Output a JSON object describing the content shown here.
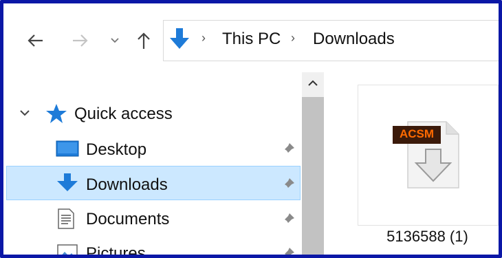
{
  "nav": {
    "back_icon": "arrow-left-icon",
    "forward_icon": "arrow-right-icon",
    "recent_icon": "chevron-down-icon",
    "up_icon": "arrow-up-icon"
  },
  "address": {
    "location_icon": "downloads-arrow-icon",
    "crumbs": [
      "This PC",
      "Downloads"
    ]
  },
  "sidebar": {
    "quick_access_label": "Quick access",
    "items": [
      {
        "label": "Desktop",
        "icon": "desktop-icon",
        "pinned": true
      },
      {
        "label": "Downloads",
        "icon": "downloads-icon",
        "pinned": true,
        "selected": true
      },
      {
        "label": "Documents",
        "icon": "documents-icon",
        "pinned": true
      },
      {
        "label": "Pictures",
        "icon": "pictures-icon",
        "pinned": true
      }
    ]
  },
  "files": [
    {
      "name": "5136588 (1)",
      "icon": "acsm-file-icon",
      "badge": "ACSM"
    }
  ],
  "colors": {
    "selection_bg": "#cce8ff",
    "accent_blue": "#1e7bd8",
    "frame_border": "#0b17a6",
    "badge_bg": "#3b1a0a",
    "badge_text": "#ff6a00"
  }
}
